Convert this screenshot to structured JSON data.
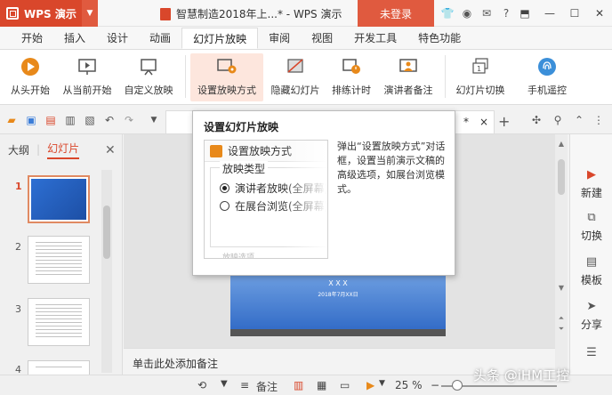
{
  "app": {
    "menu_label": "WPS 演示",
    "doc_title": "智慧制造2018年上...* - WPS 演示",
    "login_label": "未登录"
  },
  "menubar": {
    "tabs": [
      "开始",
      "插入",
      "设计",
      "动画",
      "幻灯片放映",
      "审阅",
      "视图",
      "开发工具",
      "特色功能"
    ]
  },
  "ribbon": {
    "from_start": "从头开始",
    "from_current": "从当前开始",
    "custom_show": "自定义放映",
    "setup_show": "设置放映方式",
    "hide_slide": "隐藏幻灯片",
    "rehearse": "排练计时",
    "presenter_notes": "演讲者备注",
    "slide_switch": "幻灯片切换",
    "phone_remote": "手机遥控"
  },
  "doctab": {
    "star": "*",
    "close": "×"
  },
  "left_panel": {
    "outline_tab": "大纲",
    "slides_tab": "幻灯片",
    "thumbs": [
      "1",
      "2",
      "3",
      "4"
    ]
  },
  "slide": {
    "name": "X X X",
    "date": "2018年7月XX日"
  },
  "notes_placeholder": "单击此处添加备注",
  "right_sidebar": [
    "新建",
    "切换",
    "模板",
    "分享"
  ],
  "status": {
    "notes_label": "备注",
    "zoom": "25 %"
  },
  "watermark": "头条 @iHM工控",
  "tooltip": {
    "title": "设置幻灯片放映",
    "preview_header": "设置放映方式",
    "group_title": "放映类型",
    "option1": "演讲者放映(全屏幕)",
    "option2": "在展台浏览(全屏幕)",
    "faded": "放映选项",
    "description": "弹出“设置放映方式”对话框，设置当前演示文稿的高级选项，如展台浏览模式。"
  },
  "colors": {
    "accent": "#d9472b",
    "highlight": "#fde6dd",
    "slide_blue": "#2c66c4"
  }
}
